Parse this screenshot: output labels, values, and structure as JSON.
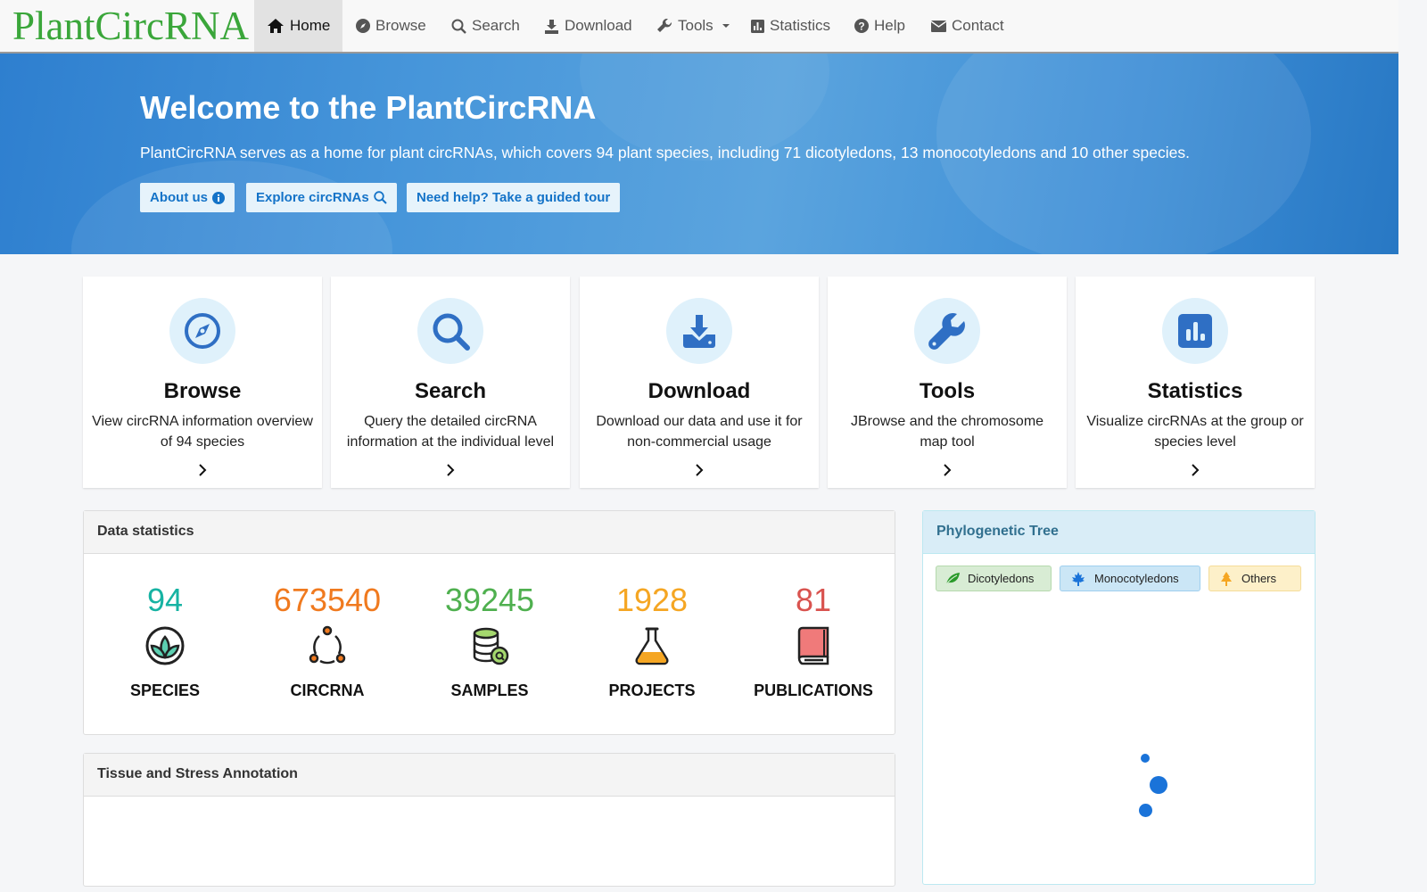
{
  "brand": "PlantCircRNA",
  "nav": [
    {
      "label": "Home",
      "icon": "home-icon",
      "active": true
    },
    {
      "label": "Browse",
      "icon": "compass-icon"
    },
    {
      "label": "Search",
      "icon": "search-icon"
    },
    {
      "label": "Download",
      "icon": "download-icon"
    },
    {
      "label": "Tools",
      "icon": "wrench-icon",
      "dropdown": true
    },
    {
      "label": "Statistics",
      "icon": "bar-chart-icon"
    },
    {
      "label": "Help",
      "icon": "question-circle-icon"
    },
    {
      "label": "Contact",
      "icon": "envelope-icon"
    }
  ],
  "hero": {
    "title": "Welcome to the PlantCircRNA",
    "text": "PlantCircRNA serves as a home for plant circRNAs, which covers 94 plant species, including 71 dicotyledons, 13 monocotyledons and 10 other species.",
    "buttons": [
      {
        "label": "About us",
        "icon": "info-circle-icon"
      },
      {
        "label": "Explore circRNAs",
        "icon": "search-icon"
      },
      {
        "label": "Need help? Take a guided tour"
      }
    ]
  },
  "cards": [
    {
      "title": "Browse",
      "desc": "View circRNA information overview of 94 species",
      "icon": "compass-icon"
    },
    {
      "title": "Search",
      "desc": "Query the detailed circRNA information at the individual level",
      "icon": "search-icon"
    },
    {
      "title": "Download",
      "desc": "Download our data and use it for non-commercial usage",
      "icon": "download-icon"
    },
    {
      "title": "Tools",
      "desc": "JBrowse and the chromosome map tool",
      "icon": "wrench-icon"
    },
    {
      "title": "Statistics",
      "desc": "Visualize circRNAs at the group or species level",
      "icon": "bar-chart-icon"
    }
  ],
  "data_statistics": {
    "title": "Data statistics",
    "items": [
      {
        "value": "94",
        "label": "SPECIES",
        "color": "#17b3a3",
        "icon": "sprout-icon"
      },
      {
        "value": "673540",
        "label": "CIRCRNA",
        "color": "#f07a1f",
        "icon": "circle-nodes-icon"
      },
      {
        "value": "39245",
        "label": "SAMPLES",
        "color": "#4fb04f",
        "icon": "database-search-icon"
      },
      {
        "value": "1928",
        "label": "PROJECTS",
        "color": "#f5a623",
        "icon": "flask-icon"
      },
      {
        "value": "81",
        "label": "PUBLICATIONS",
        "color": "#d9534f",
        "icon": "book-icon"
      }
    ]
  },
  "tissue_panel": {
    "title": "Tissue and Stress Annotation"
  },
  "phylogenetic": {
    "title": "Phylogenetic Tree",
    "legend": [
      {
        "label": "Dicotyledons",
        "icon": "leaf-icon",
        "color": "#2a9a2a"
      },
      {
        "label": "Monocotyledons",
        "icon": "maple-leaf-icon",
        "color": "#1a73d9"
      },
      {
        "label": "Others",
        "icon": "tree-icon",
        "color": "#f5a623"
      }
    ]
  },
  "colors": {
    "brand": "#3aa63a",
    "hero_bg": "#4796da",
    "accent": "#1473c8",
    "card_icon": "#2f6fc4"
  }
}
